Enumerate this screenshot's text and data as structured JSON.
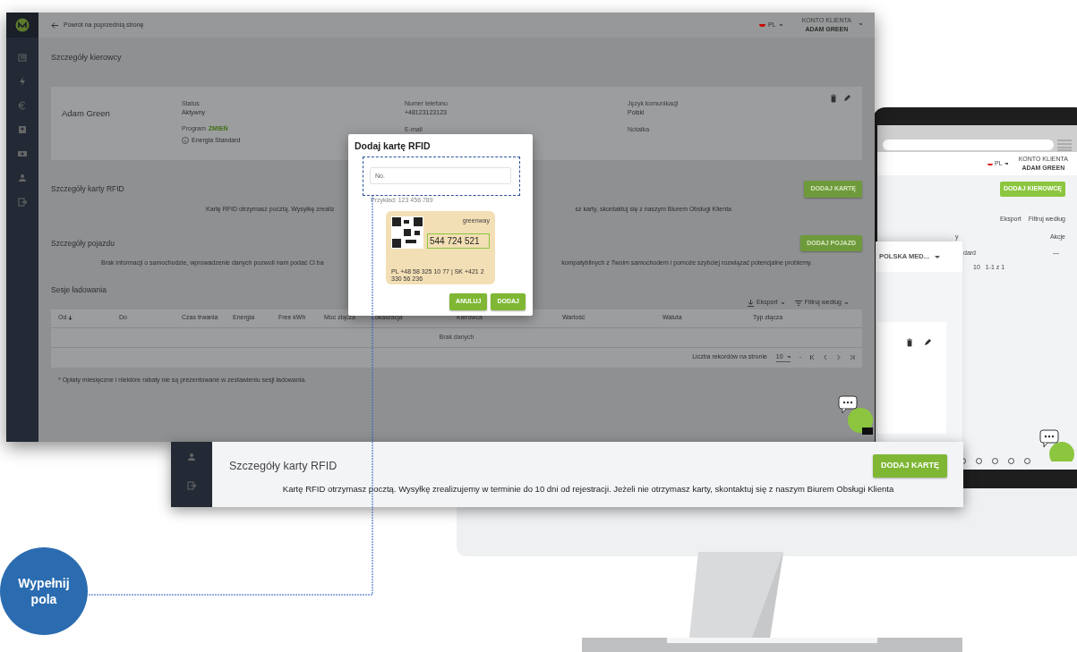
{
  "main_window": {
    "back_link": "Powrót na poprzednią stronę",
    "language": "PL",
    "account_label": "KONTO KLIENTA",
    "account_name": "ADAM GREEN",
    "page_title": "Szczegóły kierowcy",
    "driver": {
      "name": "Adam Green",
      "status_label": "Status",
      "status": "Aktywny",
      "program_label": "Program",
      "program_action": "ZMIEŃ",
      "program": "Energia Standard",
      "phone_label": "Numer telefonu",
      "phone": "+48123123123",
      "email_label": "E-mail",
      "language_label": "Język komunikacji",
      "language": "Polski",
      "note_label": "Notatka"
    },
    "rfid": {
      "title": "Szczegóły karty RFID",
      "button": "DODAJ KARTĘ",
      "note_left": "Kartę RFID otrzymasz pocztą. Wysyłkę zrealiz",
      "note_right": "sz karty, skontaktuj się z naszym Biurem Obsługi Klienta"
    },
    "vehicle": {
      "title": "Szczegóły pojazdu",
      "button": "DODAJ POJAZD",
      "note_left": "Brak informacji o samochodzie, wprowadzenie danych pozwoli nam podać Ci ba",
      "note_right": "kompatybilnych z Twoim samochodem i pomoże szybciej rozwiązać potencjalne problemy."
    },
    "sessions": {
      "title": "Sesje ładowania",
      "export": "Eksport",
      "filter": "Filtruj według",
      "columns": [
        "Od",
        "Do",
        "Czas trwania",
        "Energia",
        "Free kWh",
        "Moc złącza",
        "Lokalizacja",
        "Kierowca",
        "Wartość",
        "Waluta",
        "Typ złącza"
      ],
      "empty": "Brak danych",
      "rows_per_page_label": "Liczba rekordów na stronie",
      "rows_per_page": "10",
      "range": "-",
      "footnote": "* Opłaty miesięczne i niektóre rabaty nie są prezentowane w zestawieniu sesji ładowania."
    }
  },
  "modal": {
    "title": "Dodaj kartę RFID",
    "placeholder": "No.",
    "hint": "Przykład: 123 456 789",
    "card_brand": "greenway",
    "card_number": "544 724 521",
    "card_contact": "PL +48 58 325 10 77 | SK +421 2 330 56 236",
    "buttons": [
      "ANULUJ",
      "DODAJ"
    ]
  },
  "background_screen": {
    "language": "PL",
    "account_label": "KONTO KLIENTA",
    "account_name": "ADAM GREEN",
    "button": "DODAJ KIEROWCĘ",
    "export": "Eksport",
    "filter": "Filtruj według",
    "column_1": "y",
    "column_2": "Akcje",
    "cell_1": "dard",
    "cell_2": "—",
    "rows_per_page": "10",
    "range": "1-1 z 1"
  },
  "second_window": {
    "company": "POLSKA MED..."
  },
  "zoom_strip": {
    "title": "Szczegóły karty RFID",
    "button": "DODAJ KARTĘ",
    "note": "Kartę RFID otrzymasz pocztą. Wysyłkę zrealizujemy w terminie do 10 dni od rejestracji. Jeżeli nie otrzymasz karty, skontaktuj się z naszym Biurem Obsługi Klienta"
  },
  "callout": {
    "label": "Wypełnij pola"
  }
}
